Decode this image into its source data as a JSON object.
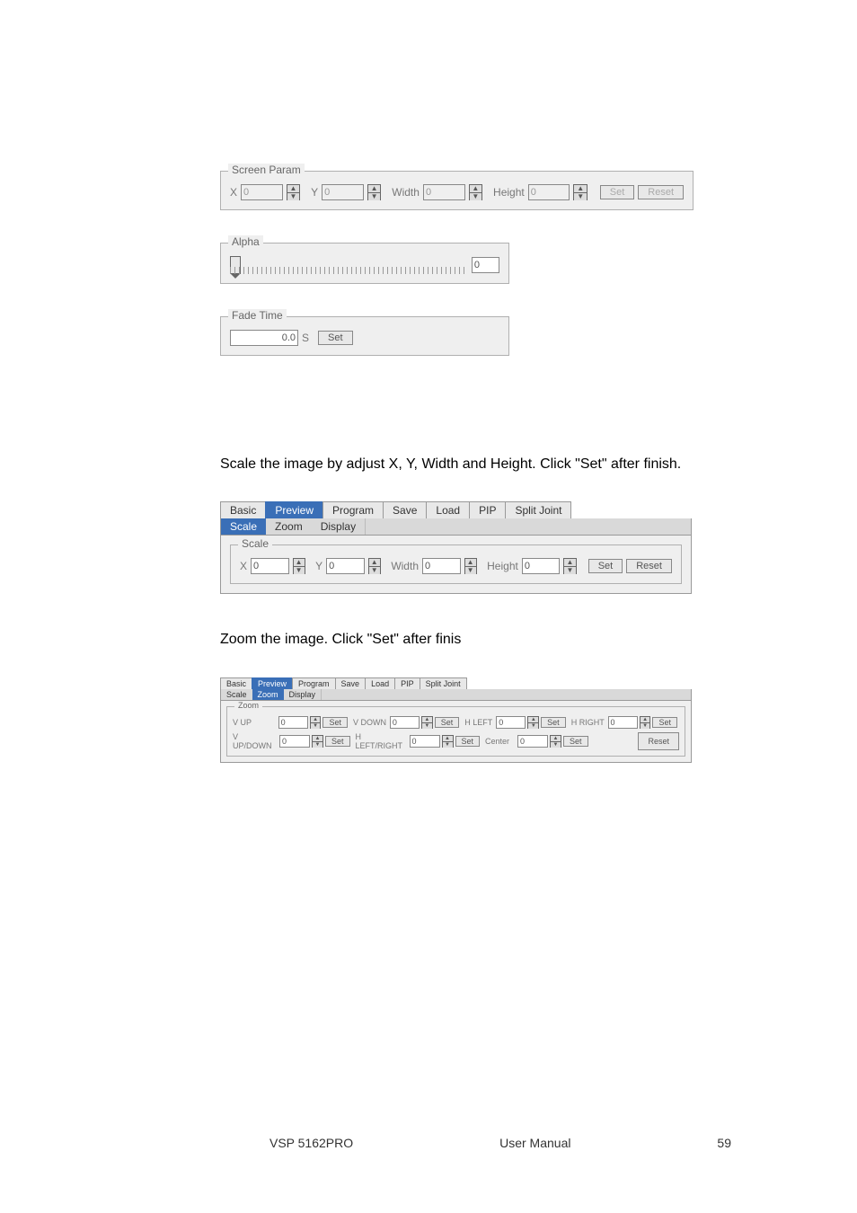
{
  "footer": {
    "product": "VSP 5162PRO",
    "doc": "User Manual",
    "page": "59"
  },
  "body_text": {
    "scale": "Scale the image by adjust X, Y, Width and Height. Click \"Set\" after finish.",
    "zoom": "Zoom the image. Click \"Set\" after finis"
  },
  "tabs_main": [
    "Basic",
    "Preview",
    "Program",
    "Save",
    "Load",
    "PIP",
    "Split Joint"
  ],
  "tabs_sub": [
    "Scale",
    "Zoom",
    "Display"
  ],
  "screen_param": {
    "legend": "Screen Param",
    "x_label": "X",
    "x_value": "0",
    "y_label": "Y",
    "y_value": "0",
    "w_label": "Width",
    "w_value": "0",
    "h_label": "Height",
    "h_value": "0",
    "set": "Set",
    "reset": "Reset"
  },
  "alpha": {
    "legend": "Alpha",
    "value": "0"
  },
  "fade": {
    "legend": "Fade Time",
    "value": "0.0",
    "unit": "S",
    "set": "Set"
  },
  "scale_panel": {
    "legend": "Scale",
    "x_label": "X",
    "x_value": "0",
    "y_label": "Y",
    "y_value": "0",
    "w_label": "Width",
    "w_value": "0",
    "h_label": "Height",
    "h_value": "0",
    "set": "Set",
    "reset": "Reset"
  },
  "zoom_panel": {
    "legend": "Zoom",
    "vup_label": "V UP",
    "vup_value": "0",
    "vdown_label": "V DOWN",
    "vdown_value": "0",
    "hleft_label": "H LEFT",
    "hleft_value": "0",
    "hright_label": "H RIGHT",
    "hright_value": "0",
    "vupdown_label": "V UP/DOWN",
    "vupdown_value": "0",
    "hlr_label": "H LEFT/RIGHT",
    "hlr_value": "0",
    "center_label": "Center",
    "center_value": "0",
    "blank_value": "0",
    "set": "Set",
    "reset": "Reset"
  }
}
